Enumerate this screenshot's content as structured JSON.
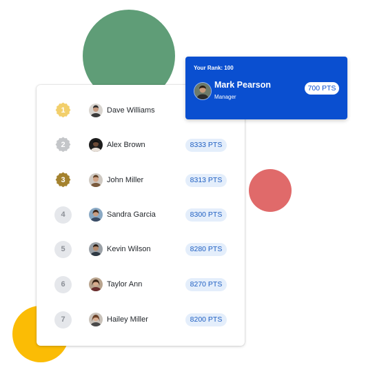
{
  "colors": {
    "green_blob": "#5f9d77",
    "red_blob": "#e06a6a",
    "yellow_blob": "#fbbc05",
    "accent_blue": "#0a4fd0",
    "gold": "#f2cf6b",
    "silver": "#c4c6c9",
    "bronze": "#a4822e"
  },
  "current_user": {
    "rank_label": "Your Rank: 100",
    "name": "Mark Pearson",
    "role": "Manager",
    "points": "700 PTS",
    "avatar_icon": "user-avatar-icon"
  },
  "leaderboard": [
    {
      "rank": "1",
      "medal": "gold-medal-icon",
      "name": "Dave Williams",
      "points": ""
    },
    {
      "rank": "2",
      "medal": "silver-medal-icon",
      "name": "Alex Brown",
      "points": "8333 PTS"
    },
    {
      "rank": "3",
      "medal": "bronze-medal-icon",
      "name": "John Miller",
      "points": "8313 PTS"
    },
    {
      "rank": "4",
      "medal": "",
      "name": "Sandra Garcia",
      "points": "8300 PTS"
    },
    {
      "rank": "5",
      "medal": "",
      "name": "Kevin Wilson",
      "points": "8280 PTS"
    },
    {
      "rank": "6",
      "medal": "",
      "name": "Taylor Ann",
      "points": "8270 PTS"
    },
    {
      "rank": "7",
      "medal": "",
      "name": "Hailey Miller",
      "points": "8200 PTS"
    }
  ]
}
